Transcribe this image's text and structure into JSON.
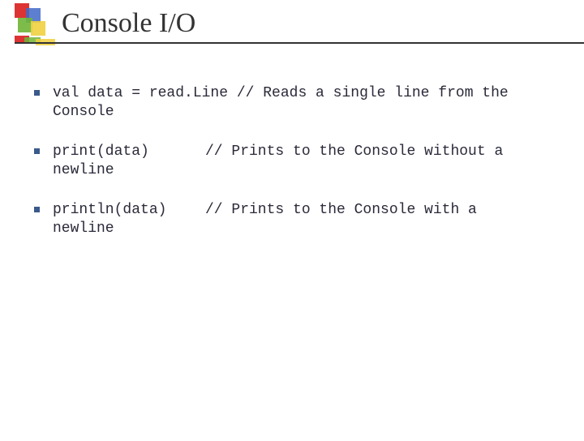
{
  "header": {
    "title": "Console I/O"
  },
  "items": [
    {
      "code_line1": "val data = read.Line ",
      "comment": "// Reads a single line from the",
      "continuation": "Console"
    },
    {
      "code_line1": "print(data)",
      "comment": "// Prints to the Console without a",
      "continuation": "newline"
    },
    {
      "code_line1": "println(data)",
      "comment": "// Prints to the Console with a",
      "continuation": "newline"
    }
  ]
}
